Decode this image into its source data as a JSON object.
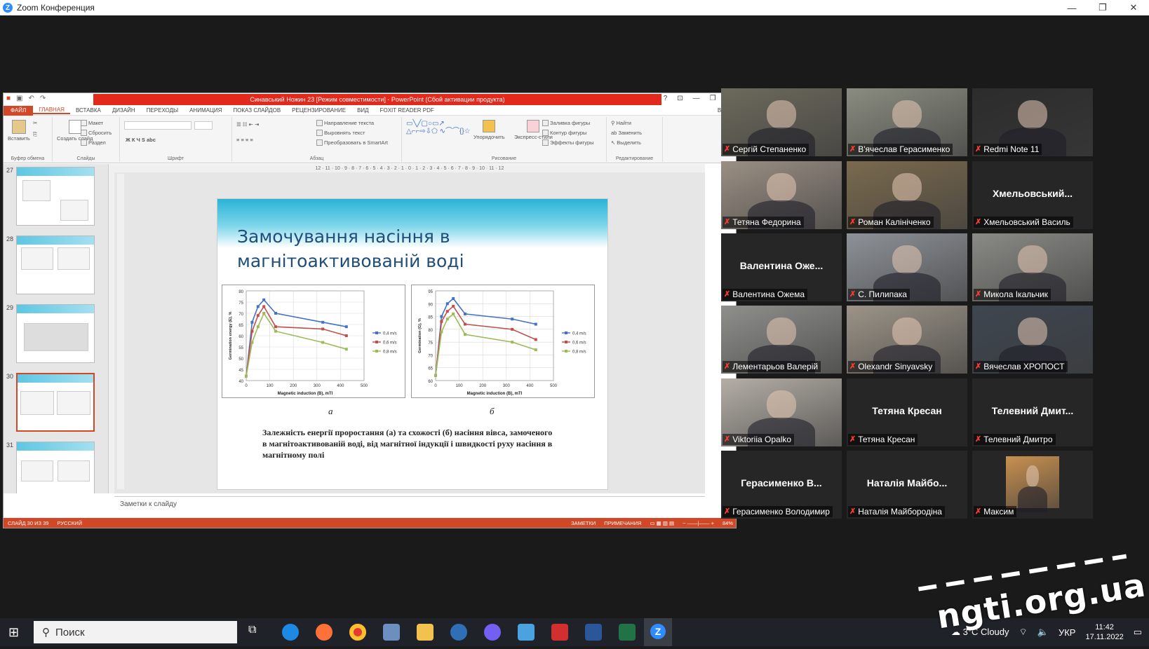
{
  "window": {
    "title": "Zoom Конференция",
    "min": "—",
    "max": "❐",
    "close": "✕"
  },
  "ppt": {
    "title": "Синавський Ножин 23 [Режим совместимости] - PowerPoint (Сбой активации продукта)",
    "tabs": [
      "ФАЙЛ",
      "ГЛАВНАЯ",
      "ВСТАВКА",
      "ДИЗАЙН",
      "ПЕРЕХОДЫ",
      "АНИМАЦИЯ",
      "ПОКАЗ СЛАЙДОВ",
      "РЕЦЕНЗИРОВАНИЕ",
      "ВИД",
      "FOXIT READER PDF"
    ],
    "signin": "Вход",
    "ribbon": {
      "paste": "Вставить",
      "clipboard": "Буфер обмена",
      "layout": "Макет",
      "reset": "Сбросить",
      "new_slide": "Создать слайд",
      "section": "Раздел",
      "slides": "Слайды",
      "font": "Шрифт",
      "paragraph": "Абзац",
      "text_dir": "Направление текста",
      "align_text": "Выровнять текст",
      "smartart": "Преобразовать в SmartArt",
      "arrange": "Упорядочить",
      "quick_styles": "Экспресс-стили",
      "shape_fill": "Заливка фигуры",
      "shape_outline": "Контур фигуры",
      "shape_effects": "Эффекты фигуры",
      "drawing": "Рисование",
      "find": "Найти",
      "replace": "Заменить",
      "select": "Выделить",
      "editing": "Редактирование"
    },
    "thumb_numbers": [
      "27",
      "28",
      "29",
      "30",
      "31"
    ],
    "ruler": "12 · 11 · 10 · 9 · 8 · 7 · 6 · 5 · 4 · 3 · 2 · 1 · 0 · 1 · 2 · 3 · 4 · 5 · 6 · 7 · 8 · 9 · 10 · 11 · 12",
    "notes": "Заметки к слайду",
    "status": {
      "slide": "СЛАЙД 30 ИЗ 39",
      "lang": "РУССКИЙ",
      "notes": "ЗАМЕТКИ",
      "comments": "ПРИМЕЧАНИЯ",
      "zoom": "84%"
    }
  },
  "slide": {
    "title": "Замочування насіння в магнітоактивованій воді",
    "label_a": "а",
    "label_b": "б",
    "caption": "Залежність енергії проростання (а) та схожості (б) насіння вівса, замоченого в магнітоактивованій воді, від магнітної індукції і швидкості руху насіння в магнітному полі"
  },
  "chart_data": [
    {
      "type": "line",
      "xlabel": "Magnetic induction (B), mTl",
      "ylabel": "Germination energy (E), %",
      "x": [
        0,
        25,
        50,
        75,
        125,
        325,
        425
      ],
      "xlim": [
        0,
        500
      ],
      "xticks": [
        0,
        100,
        200,
        300,
        400,
        500
      ],
      "ylim": [
        40,
        80
      ],
      "yticks": [
        40,
        45,
        50,
        55,
        60,
        65,
        70,
        75,
        80
      ],
      "series": [
        {
          "name": "0,4 m/s",
          "color": "#4472c4",
          "values": [
            42,
            66,
            73,
            76,
            70,
            66,
            64
          ]
        },
        {
          "name": "0,6 m/s",
          "color": "#c0504d",
          "values": [
            42,
            62,
            69,
            73,
            64,
            63,
            60
          ]
        },
        {
          "name": "0,8 m/s",
          "color": "#9bbb59",
          "values": [
            42,
            57,
            64,
            70,
            62,
            57,
            54
          ]
        }
      ]
    },
    {
      "type": "line",
      "xlabel": "Magnetic induction (B), mTl",
      "ylabel": "Germination (G), %",
      "x": [
        0,
        25,
        50,
        75,
        125,
        325,
        425
      ],
      "xlim": [
        0,
        500
      ],
      "xticks": [
        0,
        100,
        200,
        300,
        400,
        500
      ],
      "ylim": [
        60,
        95
      ],
      "yticks": [
        60,
        65,
        70,
        75,
        80,
        85,
        90,
        95
      ],
      "series": [
        {
          "name": "0,4 m/s",
          "color": "#4472c4",
          "values": [
            62,
            85,
            90,
            92,
            86,
            84,
            82
          ]
        },
        {
          "name": "0,6 m/s",
          "color": "#c0504d",
          "values": [
            62,
            83,
            87,
            89,
            82,
            80,
            76
          ]
        },
        {
          "name": "0,8 m/s",
          "color": "#9bbb59",
          "values": [
            62,
            79,
            84,
            86,
            78,
            75,
            72
          ]
        }
      ]
    }
  ],
  "participants": [
    {
      "name": "Сергій Степаненко",
      "video": true,
      "bg": "#6c6a5c"
    },
    {
      "name": "В'ячеслав Герасименко",
      "video": true,
      "bg": "#8a8c80"
    },
    {
      "name": "Redmi Note 11",
      "video": true,
      "bg": "#2c2c2c"
    },
    {
      "name": "Тетяна Федорина",
      "video": true,
      "bg": "#9a8f84"
    },
    {
      "name": "Роман Калініченко",
      "video": true,
      "bg": "#7a6a4e"
    },
    {
      "name": "Хмельовський Василь",
      "big": "Хмельовський...",
      "video": false
    },
    {
      "name": "Валентина Ожема",
      "big": "Валентина Оже...",
      "video": false
    },
    {
      "name": "С. Пилипака",
      "video": true,
      "bg": "#8e9298"
    },
    {
      "name": "Микола Ікальчик",
      "video": true,
      "bg": "#8a8a86"
    },
    {
      "name": "Лементарьов Валерій",
      "video": true,
      "bg": "#8f8f8c"
    },
    {
      "name": "Olexandr Sinyavsky",
      "video": true,
      "bg": "#9c9488",
      "active": true
    },
    {
      "name": "Вячеслав ХРОПОСТ",
      "video": true,
      "bg": "#3e4650"
    },
    {
      "name": "Viktoriia Opalko",
      "video": true,
      "bg": "#b4aea6"
    },
    {
      "name": "Тетяна Кресан",
      "big": "Тетяна Кресан",
      "video": false
    },
    {
      "name": "Телевний Дмитро",
      "big": "Телевний Дмит...",
      "video": false
    },
    {
      "name": "Герасименко Володимир",
      "big": "Герасименко В...",
      "video": false
    },
    {
      "name": "Наталія Майбородіна",
      "big": "Наталія Майбо...",
      "video": false
    },
    {
      "name": "Максим",
      "video": true,
      "bg": "#c89050",
      "small": true
    }
  ],
  "taskbar": {
    "search": "Поиск",
    "weather": "3°C Cloudy",
    "lang": "УКР",
    "time": "11:42",
    "date": "17.11.2022"
  },
  "watermark": "ngti.org.ua"
}
